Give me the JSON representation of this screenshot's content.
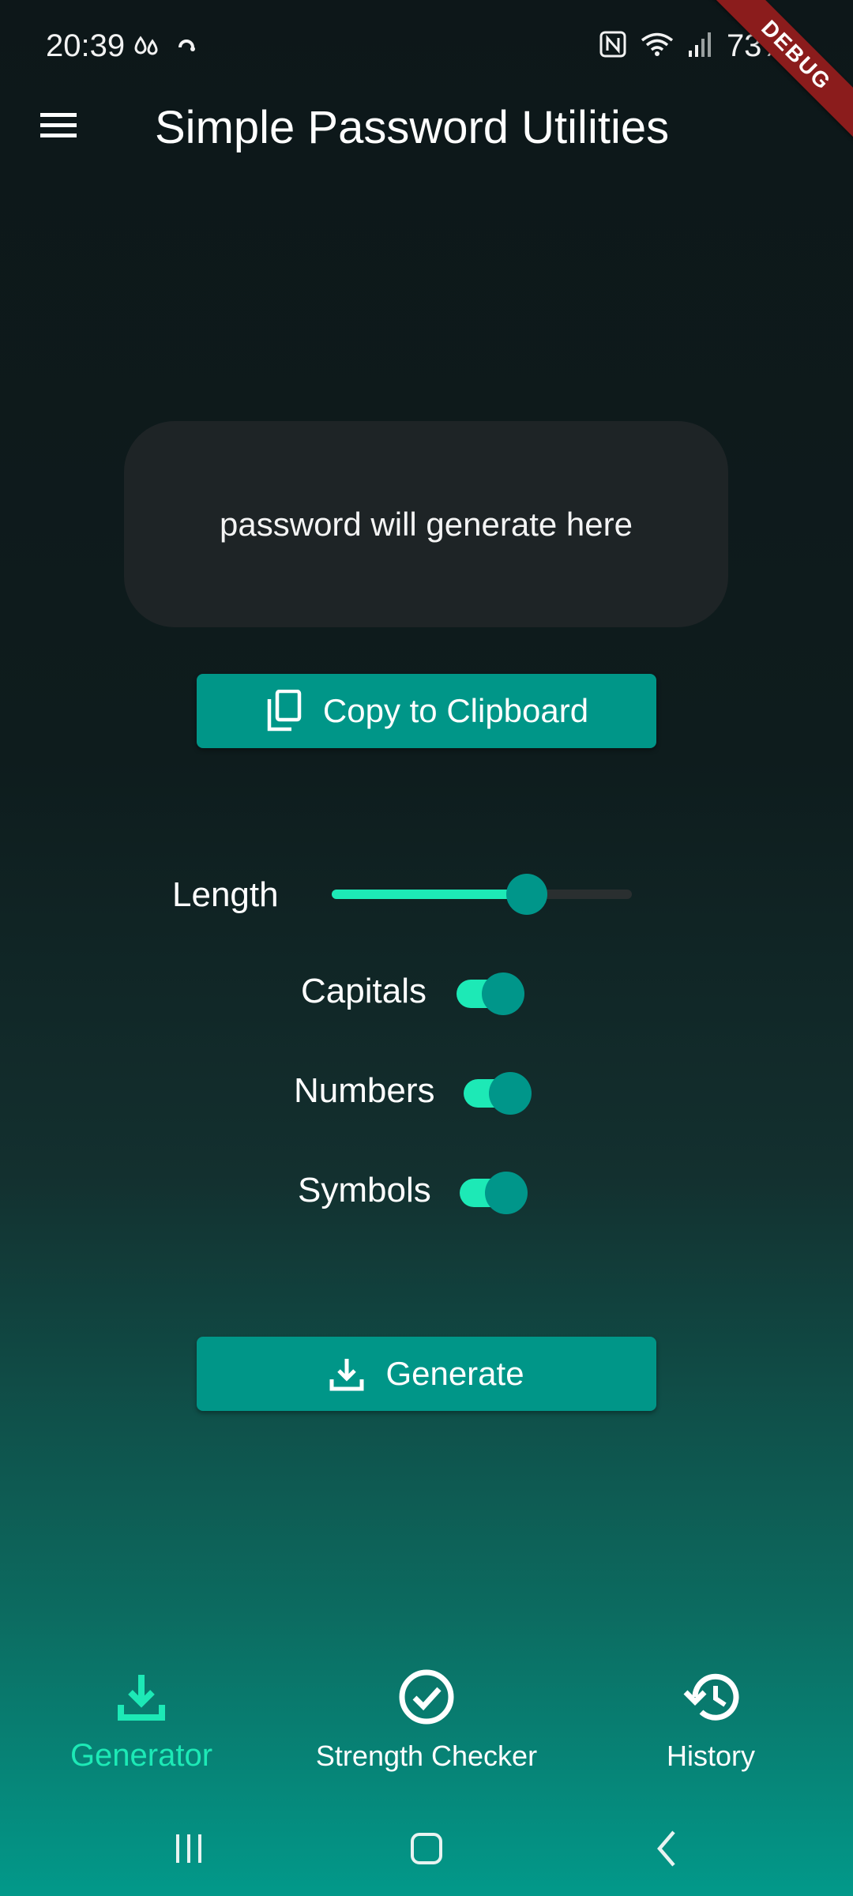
{
  "status_bar": {
    "time": "20:39",
    "battery": "73%"
  },
  "debug_banner": "DEBUG",
  "app_bar": {
    "title": "Simple Password Utilities"
  },
  "password_display": {
    "placeholder": "password will generate here"
  },
  "copy_button": {
    "label": "Copy to Clipboard"
  },
  "options": {
    "length": {
      "label": "Length",
      "value_fraction": 0.65
    },
    "toggles": [
      {
        "label": "Capitals",
        "checked": true
      },
      {
        "label": "Numbers",
        "checked": true
      },
      {
        "label": "Symbols",
        "checked": true
      }
    ]
  },
  "generate_button": {
    "label": "Generate"
  },
  "bottom_nav": {
    "items": [
      {
        "label": "Generator",
        "icon": "download-icon",
        "active": true
      },
      {
        "label": "Strength Checker",
        "icon": "check-circle-icon",
        "active": false
      },
      {
        "label": "History",
        "icon": "history-icon",
        "active": false
      }
    ]
  },
  "colors": {
    "accent": "#1de9b6",
    "primary": "#009688",
    "card": "#1e2426",
    "background_top": "#0d1719",
    "background_bottom": "#02998a"
  }
}
